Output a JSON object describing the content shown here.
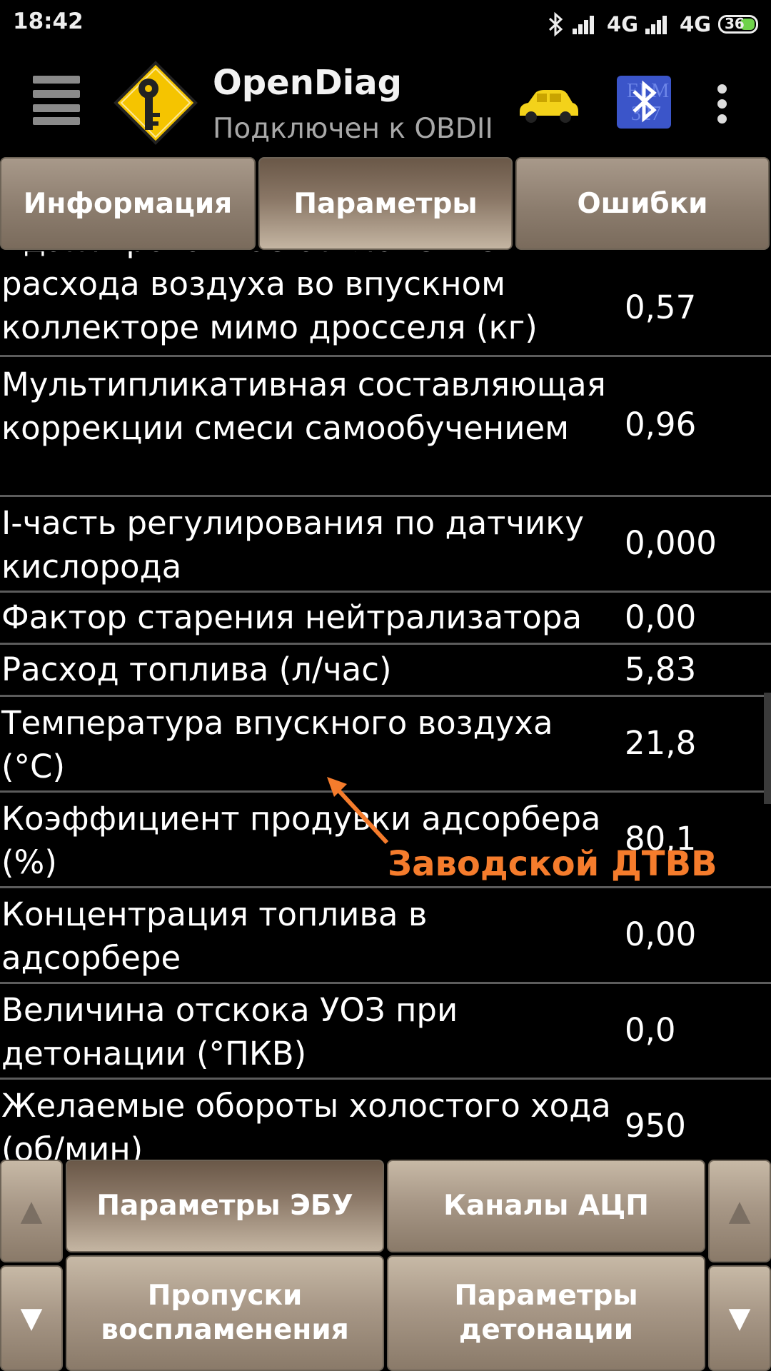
{
  "status_bar": {
    "time": "18:42",
    "network_1": "4G",
    "network_2": "4G",
    "battery": "36",
    "icons": [
      "bluetooth-icon",
      "signal-icon",
      "signal-icon",
      "battery-icon"
    ]
  },
  "app_bar": {
    "title": "OpenDiag",
    "subtitle": "Подключен к OBDII",
    "icons": [
      "menu-icon",
      "key-logo-icon",
      "car-icon",
      "elm327-bluetooth-icon",
      "overflow-icon"
    ],
    "bt_icon_text": "ELM 327"
  },
  "tabs": [
    {
      "label": "Информация",
      "active": false
    },
    {
      "label": "Параметры",
      "active": true
    },
    {
      "label": "Ошибки",
      "active": false
    }
  ],
  "parameters": [
    {
      "name": "Адаптированное отклонение расхода воздуха во впускном коллекторе мимо дросселя (кг)",
      "value": "0,57"
    },
    {
      "name": "Мультипликативная составляющая коррекции смеси самообучением",
      "value": "0,96"
    },
    {
      "name": "I-часть регулирования по датчику кислорода",
      "value": "0,000"
    },
    {
      "name": "Фактор старения нейтрализатора",
      "value": "0,00"
    },
    {
      "name": "Расход топлива (л/час)",
      "value": "5,83"
    },
    {
      "name": "Температура впускного воздуха (°C)",
      "value": "21,8"
    },
    {
      "name": "Коэффициент продувки адсорбера (%)",
      "value": "80,1"
    },
    {
      "name": "Концентрация топлива в адсорбере",
      "value": "0,00"
    },
    {
      "name": "Величина отскока УОЗ при детонации (°ПКВ)",
      "value": "0,0"
    },
    {
      "name": "Желаемые обороты холостого хода (об/мин)",
      "value": "950"
    }
  ],
  "annotation": {
    "text": "Заводской ДТВВ",
    "color": "#f57c2c"
  },
  "bottom_panel": {
    "up_arrow": "▲",
    "down_arrow": "▼",
    "buttons": [
      {
        "label": "Параметры ЭБУ",
        "active": true
      },
      {
        "label": "Каналы АЦП",
        "active": false
      },
      {
        "label": "Пропуски воспламенения",
        "active": false
      },
      {
        "label": "Параметры детонации",
        "active": false
      }
    ]
  },
  "colors": {
    "tab_active": "#8a7766",
    "tab_inactive": "#8c7d6e",
    "row_divider": "#5c5c5c",
    "accent_logo": "#f5c400"
  }
}
